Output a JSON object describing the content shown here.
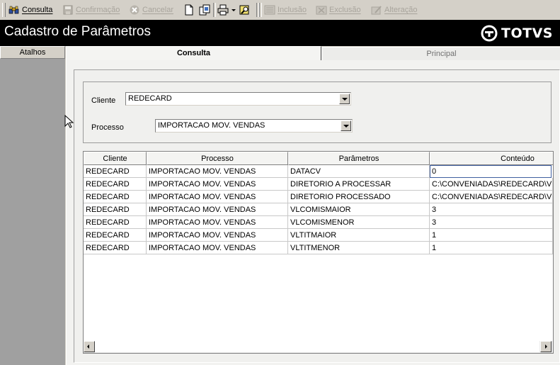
{
  "toolbar": {
    "consulta": "Consulta",
    "confirmacao": "Confirmação",
    "cancelar": "Cancelar",
    "inclusao": "Inclusão",
    "exclusao": "Exclusão",
    "alteracao": "Alteração",
    "icons": [
      "binoculars-icon",
      "save-icon",
      "cancel-icon",
      "new-document-icon",
      "copy-document-icon",
      "printer-icon",
      "dropdown-arrow-icon",
      "search-edit-icon",
      "add-record-icon",
      "delete-record-icon",
      "edit-record-icon"
    ]
  },
  "header": {
    "title": "Cadastro de Parâmetros",
    "logo": "TOTVS"
  },
  "sidebar": {
    "title": "Atalhos"
  },
  "tabs": [
    {
      "label": "Consulta",
      "active": true
    },
    {
      "label": "Principal",
      "active": false
    }
  ],
  "filters": {
    "cliente_label": "Cliente",
    "cliente_value": "REDECARD",
    "processo_label": "Processo",
    "processo_value": "IMPORTACAO MOV. VENDAS"
  },
  "grid": {
    "columns": [
      "Cliente",
      "Processo",
      "Parâmetros",
      "Conteúdo"
    ],
    "rows": [
      [
        "REDECARD",
        "IMPORTACAO MOV. VENDAS",
        "DATACV",
        "0"
      ],
      [
        "REDECARD",
        "IMPORTACAO MOV. VENDAS",
        "DIRETORIO A PROCESSAR",
        "C:\\CONVENIADAS\\REDECARD\\V"
      ],
      [
        "REDECARD",
        "IMPORTACAO MOV. VENDAS",
        "DIRETORIO PROCESSADO",
        "C:\\CONVENIADAS\\REDECARD\\V"
      ],
      [
        "REDECARD",
        "IMPORTACAO MOV. VENDAS",
        "VLCOMISMAIOR",
        "3"
      ],
      [
        "REDECARD",
        "IMPORTACAO MOV. VENDAS",
        "VLCOMISMENOR",
        "3"
      ],
      [
        "REDECARD",
        "IMPORTACAO MOV. VENDAS",
        "VLTITMAIOR",
        "1"
      ],
      [
        "REDECARD",
        "IMPORTACAO MOV. VENDAS",
        "VLTITMENOR",
        "1"
      ]
    ]
  },
  "colors": {
    "title_bar": "#000000",
    "sidebar": "#a0a0a0",
    "window": "#d4d0c8"
  }
}
